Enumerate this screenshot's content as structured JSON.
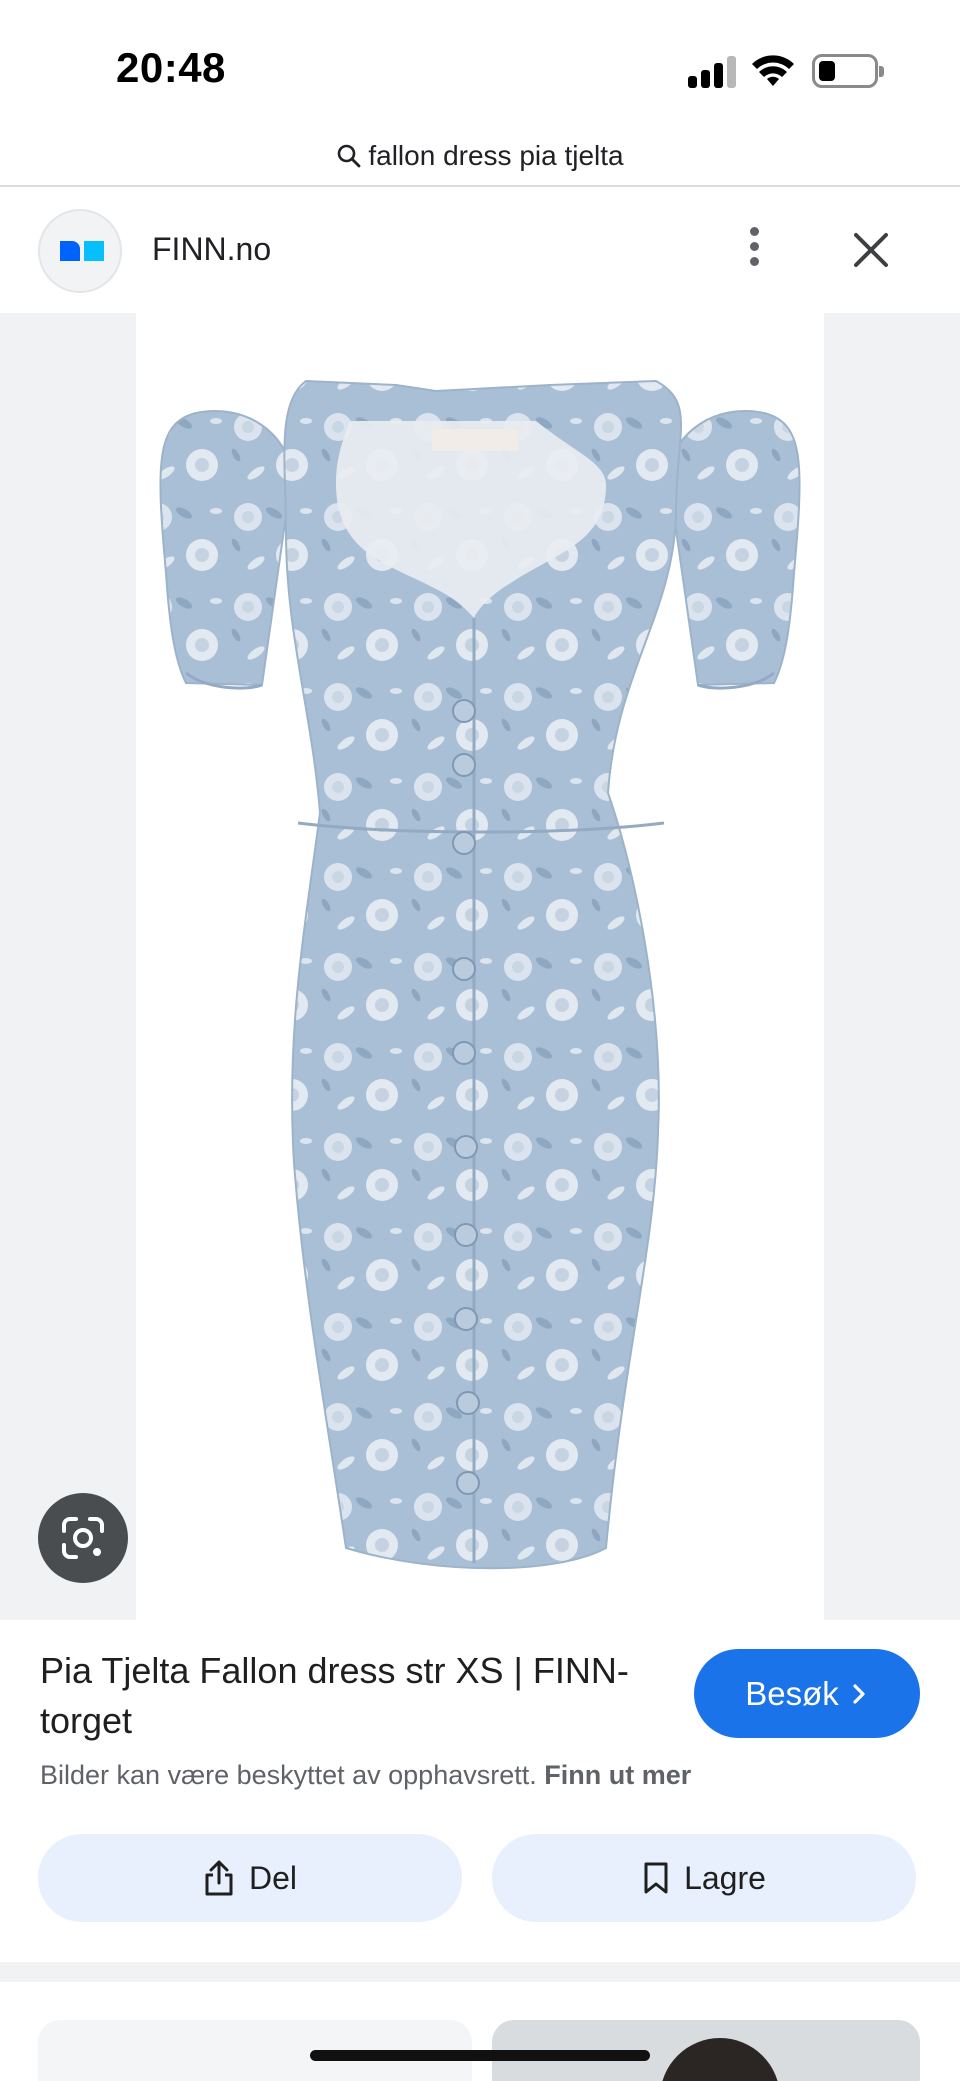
{
  "status_bar": {
    "time": "20:48"
  },
  "search": {
    "query": "fallon dress pia tjelta"
  },
  "source": {
    "name": "FINN.no"
  },
  "result": {
    "title": "Pia Tjelta Fallon dress str XS | FINN-torget",
    "visit_label": "Besøk",
    "copyright_text": "Bilder kan være beskyttet av opphavsrett.",
    "learn_more": "Finn ut mer",
    "share_label": "Del",
    "save_label": "Lagre"
  },
  "icons": {
    "search": "search-icon",
    "menu": "more-vert-icon",
    "close": "close-icon",
    "lens": "google-lens-icon",
    "visit": "chevron-right-icon",
    "share": "share-icon",
    "save": "bookmark-icon"
  },
  "colors": {
    "accent": "#1a73e8",
    "pill_bg": "#e8f0fe",
    "dress": "#a9bfd6",
    "finn_logo_blue": "#0063fb",
    "finn_logo_light": "#06bffc"
  }
}
